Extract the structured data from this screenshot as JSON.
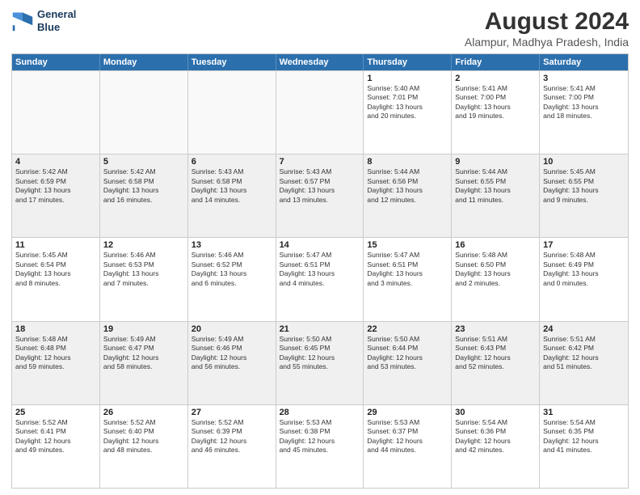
{
  "header": {
    "logo_line1": "General",
    "logo_line2": "Blue",
    "title": "August 2024",
    "subtitle": "Alampur, Madhya Pradesh, India"
  },
  "weekdays": [
    "Sunday",
    "Monday",
    "Tuesday",
    "Wednesday",
    "Thursday",
    "Friday",
    "Saturday"
  ],
  "rows": [
    [
      {
        "day": "",
        "text": "",
        "empty": true
      },
      {
        "day": "",
        "text": "",
        "empty": true
      },
      {
        "day": "",
        "text": "",
        "empty": true
      },
      {
        "day": "",
        "text": "",
        "empty": true
      },
      {
        "day": "1",
        "text": "Sunrise: 5:40 AM\nSunset: 7:01 PM\nDaylight: 13 hours\nand 20 minutes."
      },
      {
        "day": "2",
        "text": "Sunrise: 5:41 AM\nSunset: 7:00 PM\nDaylight: 13 hours\nand 19 minutes."
      },
      {
        "day": "3",
        "text": "Sunrise: 5:41 AM\nSunset: 7:00 PM\nDaylight: 13 hours\nand 18 minutes."
      }
    ],
    [
      {
        "day": "4",
        "text": "Sunrise: 5:42 AM\nSunset: 6:59 PM\nDaylight: 13 hours\nand 17 minutes."
      },
      {
        "day": "5",
        "text": "Sunrise: 5:42 AM\nSunset: 6:58 PM\nDaylight: 13 hours\nand 16 minutes."
      },
      {
        "day": "6",
        "text": "Sunrise: 5:43 AM\nSunset: 6:58 PM\nDaylight: 13 hours\nand 14 minutes."
      },
      {
        "day": "7",
        "text": "Sunrise: 5:43 AM\nSunset: 6:57 PM\nDaylight: 13 hours\nand 13 minutes."
      },
      {
        "day": "8",
        "text": "Sunrise: 5:44 AM\nSunset: 6:56 PM\nDaylight: 13 hours\nand 12 minutes."
      },
      {
        "day": "9",
        "text": "Sunrise: 5:44 AM\nSunset: 6:55 PM\nDaylight: 13 hours\nand 11 minutes."
      },
      {
        "day": "10",
        "text": "Sunrise: 5:45 AM\nSunset: 6:55 PM\nDaylight: 13 hours\nand 9 minutes."
      }
    ],
    [
      {
        "day": "11",
        "text": "Sunrise: 5:45 AM\nSunset: 6:54 PM\nDaylight: 13 hours\nand 8 minutes."
      },
      {
        "day": "12",
        "text": "Sunrise: 5:46 AM\nSunset: 6:53 PM\nDaylight: 13 hours\nand 7 minutes."
      },
      {
        "day": "13",
        "text": "Sunrise: 5:46 AM\nSunset: 6:52 PM\nDaylight: 13 hours\nand 6 minutes."
      },
      {
        "day": "14",
        "text": "Sunrise: 5:47 AM\nSunset: 6:51 PM\nDaylight: 13 hours\nand 4 minutes."
      },
      {
        "day": "15",
        "text": "Sunrise: 5:47 AM\nSunset: 6:51 PM\nDaylight: 13 hours\nand 3 minutes."
      },
      {
        "day": "16",
        "text": "Sunrise: 5:48 AM\nSunset: 6:50 PM\nDaylight: 13 hours\nand 2 minutes."
      },
      {
        "day": "17",
        "text": "Sunrise: 5:48 AM\nSunset: 6:49 PM\nDaylight: 13 hours\nand 0 minutes."
      }
    ],
    [
      {
        "day": "18",
        "text": "Sunrise: 5:48 AM\nSunset: 6:48 PM\nDaylight: 12 hours\nand 59 minutes."
      },
      {
        "day": "19",
        "text": "Sunrise: 5:49 AM\nSunset: 6:47 PM\nDaylight: 12 hours\nand 58 minutes."
      },
      {
        "day": "20",
        "text": "Sunrise: 5:49 AM\nSunset: 6:46 PM\nDaylight: 12 hours\nand 56 minutes."
      },
      {
        "day": "21",
        "text": "Sunrise: 5:50 AM\nSunset: 6:45 PM\nDaylight: 12 hours\nand 55 minutes."
      },
      {
        "day": "22",
        "text": "Sunrise: 5:50 AM\nSunset: 6:44 PM\nDaylight: 12 hours\nand 53 minutes."
      },
      {
        "day": "23",
        "text": "Sunrise: 5:51 AM\nSunset: 6:43 PM\nDaylight: 12 hours\nand 52 minutes."
      },
      {
        "day": "24",
        "text": "Sunrise: 5:51 AM\nSunset: 6:42 PM\nDaylight: 12 hours\nand 51 minutes."
      }
    ],
    [
      {
        "day": "25",
        "text": "Sunrise: 5:52 AM\nSunset: 6:41 PM\nDaylight: 12 hours\nand 49 minutes."
      },
      {
        "day": "26",
        "text": "Sunrise: 5:52 AM\nSunset: 6:40 PM\nDaylight: 12 hours\nand 48 minutes."
      },
      {
        "day": "27",
        "text": "Sunrise: 5:52 AM\nSunset: 6:39 PM\nDaylight: 12 hours\nand 46 minutes."
      },
      {
        "day": "28",
        "text": "Sunrise: 5:53 AM\nSunset: 6:38 PM\nDaylight: 12 hours\nand 45 minutes."
      },
      {
        "day": "29",
        "text": "Sunrise: 5:53 AM\nSunset: 6:37 PM\nDaylight: 12 hours\nand 44 minutes."
      },
      {
        "day": "30",
        "text": "Sunrise: 5:54 AM\nSunset: 6:36 PM\nDaylight: 12 hours\nand 42 minutes."
      },
      {
        "day": "31",
        "text": "Sunrise: 5:54 AM\nSunset: 6:35 PM\nDaylight: 12 hours\nand 41 minutes."
      }
    ]
  ]
}
